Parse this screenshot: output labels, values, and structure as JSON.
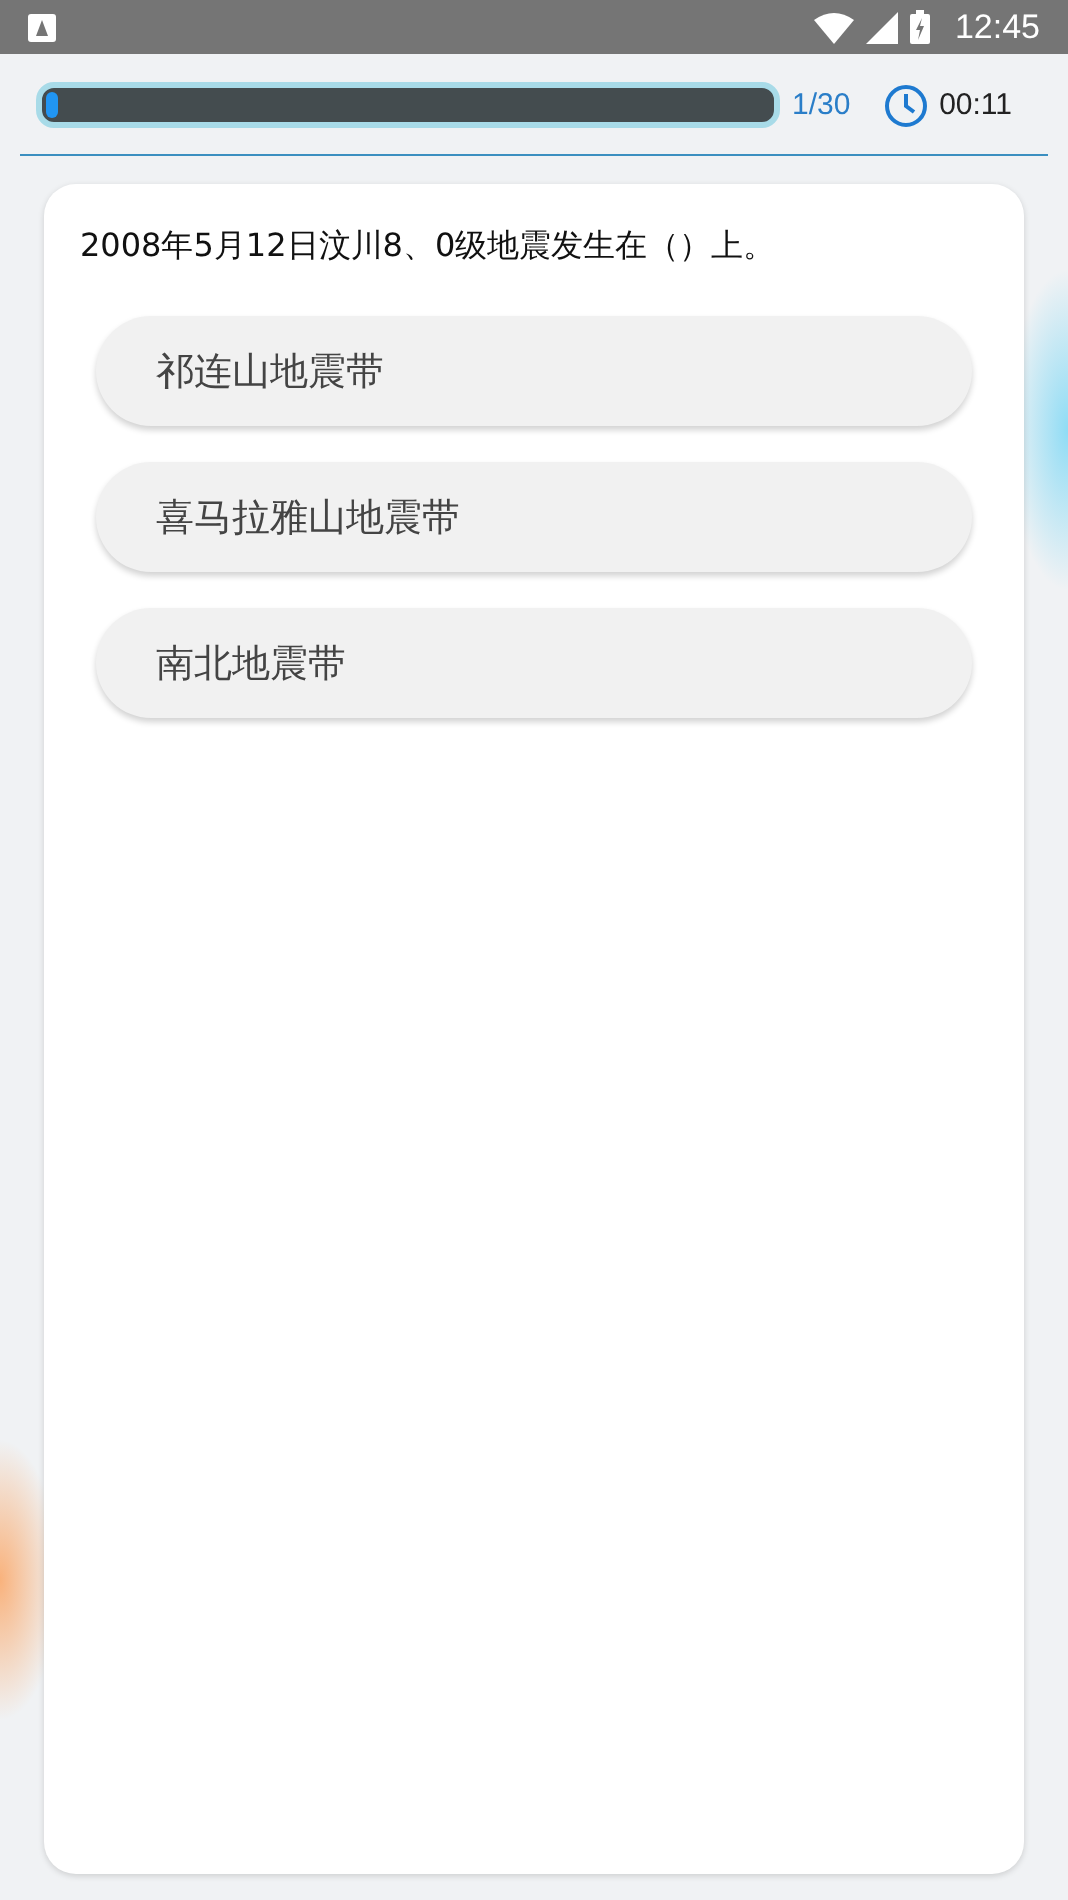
{
  "status_bar": {
    "time": "12:45"
  },
  "progress": {
    "level": 0.01,
    "count": "1/30",
    "timer": "00:11"
  },
  "question": {
    "text": "2008年5月12日汶川8、0级地震发生在（）上。",
    "options": [
      {
        "label": "祁连山地震带",
        "selected": false
      },
      {
        "label": "喜马拉雅山地震带",
        "selected": false
      },
      {
        "label": "南北地震带",
        "selected": false
      }
    ]
  }
}
